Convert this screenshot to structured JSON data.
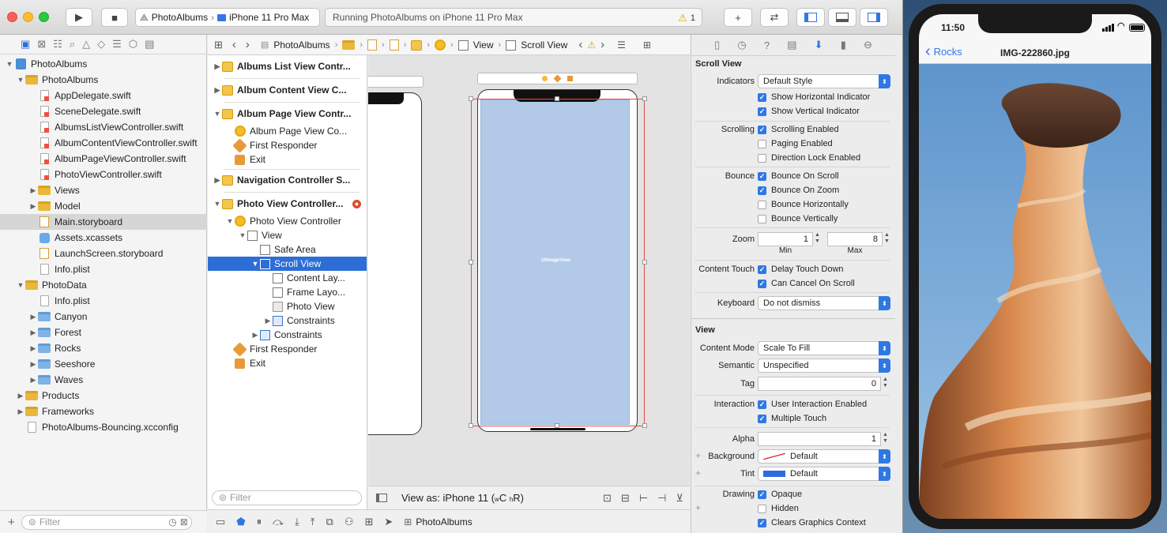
{
  "toolbar": {
    "scheme_app": "PhotoAlbums",
    "scheme_device": "iPhone 11 Pro Max",
    "activity": "Running PhotoAlbums on iPhone 11 Pro Max",
    "warning_count": "1"
  },
  "navigator": {
    "items": [
      {
        "label": "PhotoAlbums",
        "icon": "project-icon"
      },
      {
        "label": "PhotoAlbums",
        "icon": "folder-icon"
      },
      {
        "label": "AppDelegate.swift",
        "icon": "swift-file-icon"
      },
      {
        "label": "SceneDelegate.swift",
        "icon": "swift-file-icon"
      },
      {
        "label": "AlbumsListViewController.swift",
        "icon": "swift-file-icon"
      },
      {
        "label": "AlbumContentViewController.swift",
        "icon": "swift-file-icon"
      },
      {
        "label": "AlbumPageViewController.swift",
        "icon": "swift-file-icon"
      },
      {
        "label": "PhotoViewController.swift",
        "icon": "swift-file-icon"
      },
      {
        "label": "Views",
        "icon": "folder-icon"
      },
      {
        "label": "Model",
        "icon": "folder-icon"
      },
      {
        "label": "Main.storyboard",
        "icon": "storyboard-icon"
      },
      {
        "label": "Assets.xcassets",
        "icon": "assets-icon"
      },
      {
        "label": "LaunchScreen.storyboard",
        "icon": "storyboard-icon"
      },
      {
        "label": "Info.plist",
        "icon": "file-icon"
      },
      {
        "label": "PhotoData",
        "icon": "folder-icon"
      },
      {
        "label": "Info.plist",
        "icon": "file-icon"
      },
      {
        "label": "Canyon",
        "icon": "blue-folder-icon"
      },
      {
        "label": "Forest",
        "icon": "blue-folder-icon"
      },
      {
        "label": "Rocks",
        "icon": "blue-folder-icon"
      },
      {
        "label": "Seeshore",
        "icon": "blue-folder-icon"
      },
      {
        "label": "Waves",
        "icon": "blue-folder-icon"
      },
      {
        "label": "Products",
        "icon": "folder-icon"
      },
      {
        "label": "Frameworks",
        "icon": "folder-icon"
      },
      {
        "label": "PhotoAlbums-Bouncing.xcconfig",
        "icon": "file-icon"
      }
    ],
    "filter_placeholder": "Filter"
  },
  "jumpbar": {
    "crumbs": [
      "PhotoAlbums",
      "View",
      "Scroll View"
    ]
  },
  "outline": {
    "rows": [
      "Albums List View Contr...",
      "Album Content View C...",
      "Album Page View Contr...",
      "Album Page View Co...",
      "First Responder",
      "Exit",
      "Navigation Controller S...",
      "Photo View Controller...",
      "Photo View Controller",
      "View",
      "Safe Area",
      "Scroll View",
      "Content Lay...",
      "Frame Layo...",
      "Photo View",
      "Constraints",
      "Constraints",
      "First Responder",
      "Exit"
    ],
    "filter_placeholder": "Filter"
  },
  "canvas": {
    "imageview_label": "UIImageView",
    "view_as": "View as: iPhone 11 (",
    "size_class_w": "w",
    "size_class_c": "C",
    "size_class_h": "h",
    "size_class_r": "R)"
  },
  "bottombar": {
    "target": "PhotoAlbums"
  },
  "inspector": {
    "scroll_view_title": "Scroll View",
    "indicators_label": "Indicators",
    "indicators_value": "Default Style",
    "show_horizontal": "Show Horizontal Indicator",
    "show_vertical": "Show Vertical Indicator",
    "scrolling_label": "Scrolling",
    "scrolling_enabled": "Scrolling Enabled",
    "paging_enabled": "Paging Enabled",
    "direction_lock": "Direction Lock Enabled",
    "bounce_label": "Bounce",
    "bounce_on_scroll": "Bounce On Scroll",
    "bounce_on_zoom": "Bounce On Zoom",
    "bounce_horizontally": "Bounce Horizontally",
    "bounce_vertically": "Bounce Vertically",
    "zoom_label": "Zoom",
    "zoom_min": "1",
    "zoom_max": "8",
    "min_label": "Min",
    "max_label": "Max",
    "content_touch_label": "Content Touch",
    "delay_touch_down": "Delay Touch Down",
    "can_cancel_on_scroll": "Can Cancel On Scroll",
    "keyboard_label": "Keyboard",
    "keyboard_value": "Do not dismiss",
    "view_title": "View",
    "content_mode_label": "Content Mode",
    "content_mode_value": "Scale To Fill",
    "semantic_label": "Semantic",
    "semantic_value": "Unspecified",
    "tag_label": "Tag",
    "tag_value": "0",
    "interaction_label": "Interaction",
    "user_interaction": "User Interaction Enabled",
    "multiple_touch": "Multiple Touch",
    "alpha_label": "Alpha",
    "alpha_value": "1",
    "background_label": "Background",
    "background_value": "Default",
    "tint_label": "Tint",
    "tint_value": "Default",
    "drawing_label": "Drawing",
    "opaque": "Opaque",
    "hidden": "Hidden",
    "clears_graphics": "Clears Graphics Context"
  },
  "simulator": {
    "time": "11:50",
    "back_label": "Rocks",
    "title": "IMG-222860.jpg"
  },
  "colors": {
    "accent": "#2f78e4",
    "selection": "#2d6ed6",
    "tint_swatch": "#2f6be0"
  }
}
